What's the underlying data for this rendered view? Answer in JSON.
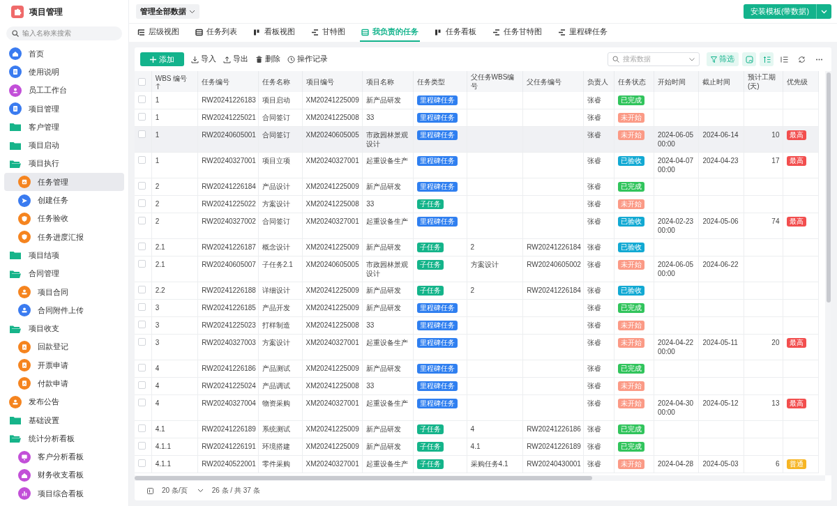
{
  "app": {
    "title": "项目管理",
    "search_placeholder": "输入名称来搜索"
  },
  "sidebar": {
    "items": [
      {
        "label": "首页",
        "kind": "home",
        "color": "#3a7bf0",
        "selected": false
      },
      {
        "label": "使用说明",
        "kind": "doc",
        "color": "#3a7bf0",
        "selected": false
      },
      {
        "label": "员工工作台",
        "kind": "user",
        "color": "#c24fd8",
        "selected": false
      },
      {
        "label": "项目管理",
        "kind": "doc",
        "color": "#3a7bf0",
        "selected": false
      },
      {
        "label": "客户管理",
        "kind": "folder",
        "expanded": false,
        "selected": false
      },
      {
        "label": "项目启动",
        "kind": "folder",
        "expanded": false,
        "selected": false
      },
      {
        "label": "项目执行",
        "kind": "folder",
        "expanded": true,
        "selected": false,
        "children": [
          {
            "label": "任务管理",
            "kind": "report",
            "color": "#f5841f",
            "selected": true
          },
          {
            "label": "创建任务",
            "kind": "send",
            "color": "#3a7bf0",
            "selected": false
          },
          {
            "label": "任务验收",
            "kind": "shield",
            "color": "#f5841f",
            "selected": false
          },
          {
            "label": "任务进度汇报",
            "kind": "shield",
            "color": "#f5841f",
            "selected": false
          }
        ]
      },
      {
        "label": "项目结项",
        "kind": "folder",
        "expanded": false,
        "selected": false
      },
      {
        "label": "合同管理",
        "kind": "folder",
        "expanded": true,
        "selected": false,
        "children": [
          {
            "label": "项目合同",
            "kind": "stamp",
            "color": "#f5841f",
            "selected": false
          },
          {
            "label": "合同附件上传",
            "kind": "stamp",
            "color": "#3a7bf0",
            "selected": false
          }
        ]
      },
      {
        "label": "项目收支",
        "kind": "folder",
        "expanded": true,
        "selected": false,
        "children": [
          {
            "label": "回款登记",
            "kind": "receipt",
            "color": "#f5841f",
            "selected": false
          },
          {
            "label": "开票申请",
            "kind": "receipt",
            "color": "#f5841f",
            "selected": false
          },
          {
            "label": "付款申请",
            "kind": "receipt",
            "color": "#f5841f",
            "selected": false
          }
        ]
      },
      {
        "label": "发布公告",
        "kind": "stamp",
        "color": "#f5841f",
        "selected": false
      },
      {
        "label": "基础设置",
        "kind": "folder",
        "expanded": false,
        "selected": false
      },
      {
        "label": "统计分析看板",
        "kind": "folder",
        "expanded": true,
        "selected": false,
        "children": [
          {
            "label": "客户分析看板",
            "kind": "board",
            "color": "#c24fd8",
            "selected": false
          },
          {
            "label": "财务收支看板",
            "kind": "home",
            "color": "#c24fd8",
            "selected": false
          },
          {
            "label": "项目综合看板",
            "kind": "chart",
            "color": "#c24fd8",
            "selected": false
          }
        ]
      }
    ]
  },
  "topbar": {
    "scope": "管理全部数据",
    "install_button": "安装模板(带数据)"
  },
  "tabs": [
    {
      "label": "层级视图",
      "kind": "tree",
      "selected": false
    },
    {
      "label": "任务列表",
      "kind": "list",
      "selected": false
    },
    {
      "label": "看板视图",
      "kind": "board",
      "selected": false
    },
    {
      "label": "甘特图",
      "kind": "gantt",
      "selected": false
    },
    {
      "label": "我负责的任务",
      "kind": "list",
      "selected": true
    },
    {
      "label": "任务看板",
      "kind": "board",
      "selected": false
    },
    {
      "label": "任务甘特图",
      "kind": "gantt",
      "selected": false
    },
    {
      "label": "里程碑任务",
      "kind": "gantt",
      "selected": false
    }
  ],
  "toolbar": {
    "add": "添加",
    "actions": [
      {
        "label": "导入",
        "kind": "import"
      },
      {
        "label": "导出",
        "kind": "export"
      },
      {
        "label": "删除",
        "kind": "delete"
      },
      {
        "label": "操作记录",
        "kind": "history"
      }
    ],
    "search_placeholder": "搜索数据",
    "filter": "筛选",
    "view_options": [
      {
        "kind": "note",
        "on": true
      },
      {
        "kind": "sort",
        "on": true
      },
      {
        "kind": "rows",
        "on": false
      },
      {
        "kind": "refresh",
        "on": false
      },
      {
        "kind": "more",
        "on": false
      }
    ]
  },
  "table": {
    "all_checked": false,
    "columns": [
      {
        "label": "WBS 编号",
        "sorted": true
      },
      {
        "label": "任务编号",
        "sorted": false
      },
      {
        "label": "任务名称",
        "sorted": false
      },
      {
        "label": "项目编号",
        "sorted": false
      },
      {
        "label": "项目名称",
        "sorted": false
      },
      {
        "label": "任务类型",
        "sorted": false
      },
      {
        "label": "父任务WBS编号",
        "sorted": false
      },
      {
        "label": "父任务编号",
        "sorted": false
      },
      {
        "label": "负责人",
        "sorted": false
      },
      {
        "label": "任务状态",
        "sorted": false
      },
      {
        "label": "开始时间",
        "sorted": false
      },
      {
        "label": "截止时间",
        "sorted": false
      },
      {
        "label": "预计工期(天)",
        "sorted": false
      },
      {
        "label": "优先级",
        "sorted": false
      }
    ],
    "rows": [
      {
        "checked": false,
        "hovered": false,
        "wbs": "1",
        "task_no": "RW20241226183",
        "task_name": "项目启动",
        "project_no": "XM20241225009",
        "project_name": "新产品研发",
        "type": {
          "text": "里程碑任务",
          "color": "#2f7ff0"
        },
        "owner": "张睿",
        "status": {
          "text": "已完成",
          "color": "#31c45c"
        }
      },
      {
        "checked": false,
        "hovered": false,
        "wbs": "1",
        "task_no": "RW20241225021",
        "task_name": "合同签订",
        "project_no": "XM20241225008",
        "project_name": "33",
        "type": {
          "text": "里程碑任务",
          "color": "#2f7ff0"
        },
        "owner": "张睿",
        "status": {
          "text": "未开始",
          "color": "#fb9a86"
        }
      },
      {
        "checked": false,
        "hovered": true,
        "wbs": "1",
        "task_no": "RW20240605001",
        "task_name": "合同签订",
        "project_no": "XM20240605005",
        "project_name": "市政园林景观设计",
        "type": {
          "text": "里程碑任务",
          "color": "#2f7ff0"
        },
        "owner": "张睿",
        "status": {
          "text": "未开始",
          "color": "#fb9a86"
        },
        "start": "2024-06-05 00:00",
        "end": "2024-06-14",
        "days": "10",
        "priority": {
          "text": "最高",
          "color": "#f24e4e"
        }
      },
      {
        "checked": false,
        "hovered": false,
        "wbs": "1",
        "task_no": "RW20240327001",
        "task_name": "项目立项",
        "project_no": "XM20240327001",
        "project_name": "起重设备生产",
        "type": {
          "text": "里程碑任务",
          "color": "#2f7ff0"
        },
        "owner": "张睿",
        "status": {
          "text": "已验收",
          "color": "#12a9d3"
        },
        "start": "2024-04-07 00:00",
        "end": "2024-04-23",
        "days": "17",
        "priority": {
          "text": "最高",
          "color": "#f24e4e"
        }
      },
      {
        "checked": false,
        "hovered": false,
        "wbs": "2",
        "task_no": "RW20241226184",
        "task_name": "产品设计",
        "project_no": "XM20241225009",
        "project_name": "新产品研发",
        "type": {
          "text": "里程碑任务",
          "color": "#2f7ff0"
        },
        "owner": "张睿",
        "status": {
          "text": "已完成",
          "color": "#31c45c"
        }
      },
      {
        "checked": false,
        "hovered": false,
        "wbs": "2",
        "task_no": "RW20241225022",
        "task_name": "方案设计",
        "project_no": "XM20241225008",
        "project_name": "33",
        "type": {
          "text": "子任务",
          "color": "#14b48a"
        },
        "owner": "张睿",
        "status": {
          "text": "未开始",
          "color": "#fb9a86"
        }
      },
      {
        "checked": false,
        "hovered": false,
        "wbs": "2",
        "task_no": "RW20240327002",
        "task_name": "合同签订",
        "project_no": "XM20240327001",
        "project_name": "起重设备生产",
        "type": {
          "text": "里程碑任务",
          "color": "#2f7ff0"
        },
        "owner": "张睿",
        "status": {
          "text": "已验收",
          "color": "#12a9d3"
        },
        "start": "2024-02-23 00:00",
        "end": "2024-05-06",
        "days": "74",
        "priority": {
          "text": "最高",
          "color": "#f24e4e"
        }
      },
      {
        "checked": false,
        "hovered": false,
        "wbs": "2.1",
        "task_no": "RW20241226187",
        "task_name": "概念设计",
        "project_no": "XM20241225009",
        "project_name": "新产品研发",
        "type": {
          "text": "子任务",
          "color": "#14b48a"
        },
        "parent_wbs": "2",
        "parent_no": "RW20241226184",
        "owner": "张睿",
        "status": {
          "text": "已验收",
          "color": "#12a9d3"
        }
      },
      {
        "checked": false,
        "hovered": false,
        "wbs": "2.1",
        "task_no": "RW20240605007",
        "task_name": "子任务2.1",
        "project_no": "XM20240605005",
        "project_name": "市政园林景观设计",
        "type": {
          "text": "子任务",
          "color": "#14b48a"
        },
        "parent_wbs": "方案设计",
        "parent_no": "RW20240605002",
        "owner": "张睿",
        "status": {
          "text": "未开始",
          "color": "#fb9a86"
        },
        "start": "2024-06-05 00:00",
        "end": "2024-06-22"
      },
      {
        "checked": false,
        "hovered": false,
        "wbs": "2.2",
        "task_no": "RW20241226188",
        "task_name": "详细设计",
        "project_no": "XM20241225009",
        "project_name": "新产品研发",
        "type": {
          "text": "子任务",
          "color": "#14b48a"
        },
        "parent_wbs": "2",
        "parent_no": "RW20241226184",
        "owner": "张睿",
        "status": {
          "text": "已验收",
          "color": "#12a9d3"
        }
      },
      {
        "checked": false,
        "hovered": false,
        "wbs": "3",
        "task_no": "RW20241226185",
        "task_name": "产品开发",
        "project_no": "XM20241225009",
        "project_name": "新产品研发",
        "type": {
          "text": "里程碑任务",
          "color": "#2f7ff0"
        },
        "owner": "张睿",
        "status": {
          "text": "已完成",
          "color": "#31c45c"
        }
      },
      {
        "checked": false,
        "hovered": false,
        "wbs": "3",
        "task_no": "RW20241225023",
        "task_name": "打样制造",
        "project_no": "XM20241225008",
        "project_name": "33",
        "type": {
          "text": "里程碑任务",
          "color": "#2f7ff0"
        },
        "owner": "张睿",
        "status": {
          "text": "未开始",
          "color": "#fb9a86"
        }
      },
      {
        "checked": false,
        "hovered": false,
        "wbs": "3",
        "task_no": "RW20240327003",
        "task_name": "方案设计",
        "project_no": "XM20240327001",
        "project_name": "起重设备生产",
        "type": {
          "text": "里程碑任务",
          "color": "#2f7ff0"
        },
        "owner": "张睿",
        "status": {
          "text": "未开始",
          "color": "#fb9a86"
        },
        "start": "2024-04-22 00:00",
        "end": "2024-05-11",
        "days": "20",
        "priority": {
          "text": "最高",
          "color": "#f24e4e"
        }
      },
      {
        "checked": false,
        "hovered": false,
        "wbs": "4",
        "task_no": "RW20241226186",
        "task_name": "产品测试",
        "project_no": "XM20241225009",
        "project_name": "新产品研发",
        "type": {
          "text": "里程碑任务",
          "color": "#2f7ff0"
        },
        "owner": "张睿",
        "status": {
          "text": "已完成",
          "color": "#31c45c"
        }
      },
      {
        "checked": false,
        "hovered": false,
        "wbs": "4",
        "task_no": "RW20241225024",
        "task_name": "产品调试",
        "project_no": "XM20241225008",
        "project_name": "33",
        "type": {
          "text": "里程碑任务",
          "color": "#2f7ff0"
        },
        "owner": "张睿",
        "status": {
          "text": "未开始",
          "color": "#fb9a86"
        }
      },
      {
        "checked": false,
        "hovered": false,
        "wbs": "4",
        "task_no": "RW20240327004",
        "task_name": "物资采购",
        "project_no": "XM20240327001",
        "project_name": "起重设备生产",
        "type": {
          "text": "里程碑任务",
          "color": "#2f7ff0"
        },
        "owner": "张睿",
        "status": {
          "text": "未开始",
          "color": "#fb9a86"
        },
        "start": "2024-04-30 00:00",
        "end": "2024-05-12",
        "days": "13",
        "priority": {
          "text": "最高",
          "color": "#f24e4e"
        }
      },
      {
        "checked": false,
        "hovered": false,
        "wbs": "4.1",
        "task_no": "RW20241226189",
        "task_name": "系统测试",
        "project_no": "XM20241225009",
        "project_name": "新产品研发",
        "type": {
          "text": "子任务",
          "color": "#14b48a"
        },
        "parent_wbs": "4",
        "parent_no": "RW20241226186",
        "owner": "张睿",
        "status": {
          "text": "已完成",
          "color": "#31c45c"
        }
      },
      {
        "checked": false,
        "hovered": false,
        "wbs": "4.1.1",
        "task_no": "RW20241226191",
        "task_name": "环境搭建",
        "project_no": "XM20241225009",
        "project_name": "新产品研发",
        "type": {
          "text": "子任务",
          "color": "#14b48a"
        },
        "parent_wbs": "4.1",
        "parent_no": "RW20241226189",
        "owner": "张睿",
        "status": {
          "text": "已完成",
          "color": "#31c45c"
        }
      },
      {
        "checked": false,
        "hovered": false,
        "wbs": "4.1.1",
        "task_no": "RW20240522001",
        "task_name": "零件采购",
        "project_no": "XM20240327001",
        "project_name": "起重设备生产",
        "type": {
          "text": "子任务",
          "color": "#14b48a"
        },
        "parent_wbs": "采购任务4.1",
        "parent_no": "RW20240430001",
        "owner": "张睿",
        "status": {
          "text": "未开始",
          "color": "#fb9a86"
        },
        "start": "2024-04-28",
        "end": "2024-05-03",
        "days": "6",
        "priority": {
          "text": "普通",
          "color": "#f6b524"
        }
      }
    ]
  },
  "pagination": {
    "page_size": "20 条/页",
    "range": "26 条 / 共 37 条"
  }
}
